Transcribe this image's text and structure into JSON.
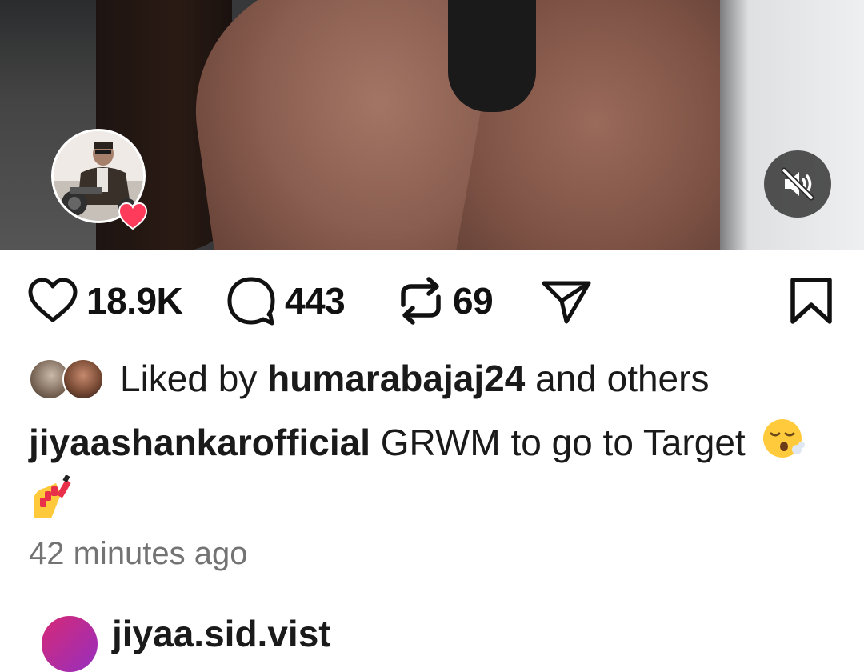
{
  "post": {
    "likes_count": "18.9K",
    "comments_count": "443",
    "reposts_count": "69",
    "liked_by_prefix": "Liked by",
    "liked_by_user": "humarabajaj24",
    "liked_by_suffix": "and others",
    "author": "jiyaashankarofficial",
    "caption_text": "GRWM to go to Target",
    "caption_emojis": [
      "face-exhaling-emoji",
      "nail-polish-emoji"
    ],
    "timestamp": "42 minutes ago",
    "next_user_partial": "jiyaa.sid.vist"
  },
  "icons": {
    "like": "heart-outline-icon",
    "comment": "comment-bubble-icon",
    "repost": "repost-icon",
    "share": "send-icon",
    "save": "bookmark-icon",
    "mute": "speaker-muted-icon",
    "badge": "heart-badge-icon"
  },
  "colors": {
    "heart_badge": "#ff3b5c",
    "muted_text": "#737373",
    "text": "#1a1a1a"
  }
}
